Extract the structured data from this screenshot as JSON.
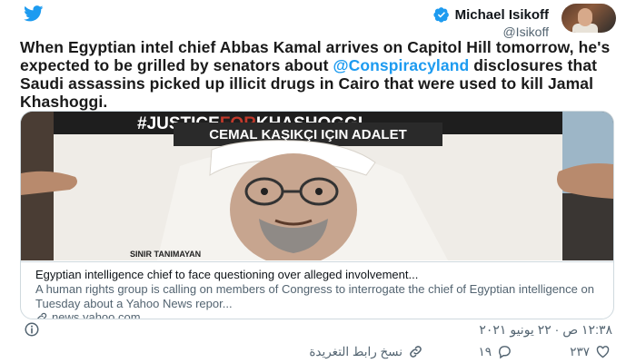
{
  "header": {
    "author_name": "Michael Isikoff",
    "author_handle": "@Isikoff"
  },
  "tweet": {
    "text_before": "When Egyptian intel chief Abbas Kamal arrives on Capitol Hill tomorrow, he's expected to be grilled by senators about ",
    "mention": "@Conspiracyland",
    "text_after": " disclosures that Saudi assassins picked up illicit drugs in Cairo that were used to kill Jamal Khashoggi."
  },
  "card": {
    "image": {
      "banner_prefix": "#JUSTICE",
      "banner_highlight": "FOR",
      "banner_suffix": "KHASHOGGI",
      "subtitle": "CEMAL KAŞIKÇI IÇIN ADALET",
      "footer_text": "SINIR TANIMAYAN"
    },
    "title": "Egyptian intelligence chief to face questioning over alleged involvement...",
    "description": "A human rights group is calling on members of Congress to interrogate the chief of Egyptian intelligence on Tuesday about a Yahoo News repor...",
    "domain": "news.yahoo.com"
  },
  "timestamp": "١٢:٣٨ ص · ٢٢ يونيو ٢٠٢١",
  "actions": {
    "likes": "٢٣٧",
    "replies": "١٩",
    "copy_link_label": "نسخ رابط التغريدة"
  },
  "colors": {
    "accent": "#1d9bf0",
    "banner_red": "#c0392b"
  }
}
